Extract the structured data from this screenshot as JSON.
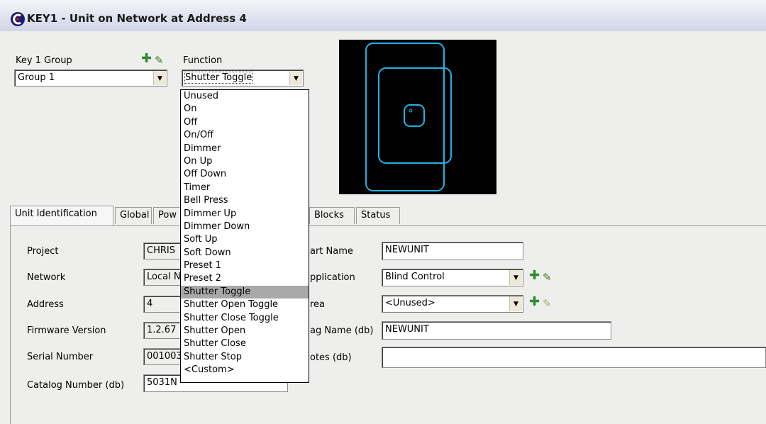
{
  "window": {
    "title": "KEY1 - Unit on Network at Address 4"
  },
  "group_section": {
    "label": "Key 1 Group",
    "value": "Group 1"
  },
  "function_section": {
    "label": "Function",
    "value": "Shutter Toggle"
  },
  "function_options": [
    "Unused",
    "On",
    "Off",
    "On/Off",
    "Dimmer",
    "On Up",
    "Off Down",
    "Timer",
    "Bell Press",
    "Dimmer Up",
    "Dimmer Down",
    "Soft Up",
    "Soft Down",
    "Preset 1",
    "Preset 2",
    "Shutter Toggle",
    "Shutter Open Toggle",
    "Shutter Close Toggle",
    "Shutter Open",
    "Shutter Close",
    "Shutter Stop",
    "<Custom>"
  ],
  "function_selected": "Shutter Toggle",
  "tabs": {
    "unit_identification": "Unit Identification",
    "global": "Global",
    "power": "Pow",
    "blocks": "Blocks",
    "status": "Status"
  },
  "left_fields": {
    "project_label": "Project",
    "project_value": "CHRIS",
    "network_label": "Network",
    "network_value": "Local N",
    "address_label": "Address",
    "address_value": "4",
    "firmware_label": "Firmware Version",
    "firmware_value": "1.2.67",
    "serial_label": "Serial Number",
    "serial_value": "001003",
    "catalog_label": "Catalog Number (db)",
    "catalog_value": "5031N"
  },
  "right_fields": {
    "part_name_label": "art Name",
    "part_name_value": "NEWUNIT",
    "application_label": "pplication",
    "application_value": "Blind Control",
    "area_label": "rea",
    "area_value": "<Unused>",
    "tag_name_label": "ag Name (db)",
    "tag_name_value": "NEWUNIT",
    "notes_label": "otes (db)",
    "notes_value": ""
  },
  "icons": {
    "add": "plus-icon",
    "edit": "pencil-icon",
    "expand": "chevron-down-icon",
    "logo": "app-logo-icon"
  },
  "colors": {
    "preview_bg": "#000000",
    "preview_outline": "#1fb4e6",
    "add_icon": "#2e8b2e",
    "highlight": "#a8a8a8"
  }
}
